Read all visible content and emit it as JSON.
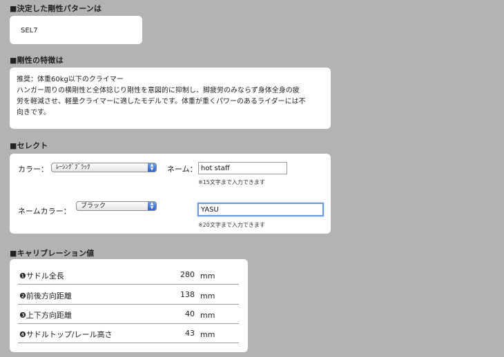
{
  "pattern": {
    "heading": "■決定した剛性パターンは",
    "value": "SEL7"
  },
  "features": {
    "heading": "■剛性の特徴は",
    "lines": [
      "推奨：体重60kg以下のクライマー",
      "ハンガー周りの横剛性と全体捻じり剛性を意図的に抑制し、脚疲労のみならず身体全身の疲",
      "労を軽減させ、軽量クライマーに適したモデルです。体重が重くパワーのあるライダーには不",
      "向きです。"
    ]
  },
  "select": {
    "heading": "■セレクト",
    "color_label": "カラー：",
    "color_value": "ﾚｰｼﾝｸﾞﾌﾞﾗｯｸ",
    "name_label": "ネーム：",
    "name_value": "hot staff",
    "name_hint": "※15文字まで入力できます",
    "name_color_label": "ネームカラー：",
    "name_color_value": "ブラック",
    "name2_value": "YASU",
    "name2_hint": "※20文字まで入力できます"
  },
  "calibration": {
    "heading": "■キャリブレーション値",
    "rows": [
      {
        "name": "❶サドル全長",
        "value": "280",
        "unit": "mm"
      },
      {
        "name": "❷前後方向距離",
        "value": "138",
        "unit": "mm"
      },
      {
        "name": "❸上下方向距離",
        "value": "40",
        "unit": "mm"
      },
      {
        "name": "❹サドルトップ/レール高さ",
        "value": "43",
        "unit": "mm"
      }
    ]
  },
  "colors": {
    "page_bg": "#b3b3b3",
    "card_bg": "#ffffff",
    "focus_ring": "#6b9ae0",
    "select_arrow": "#2d63c8"
  }
}
